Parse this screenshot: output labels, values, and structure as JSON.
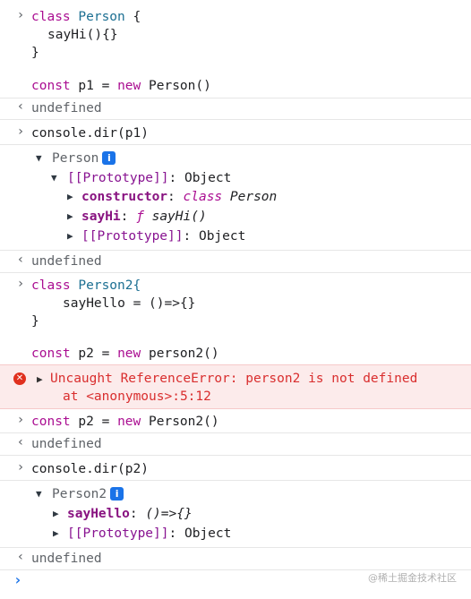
{
  "console": {
    "in1": {
      "line1": [
        "class",
        "Person",
        "{"
      ],
      "line2": "sayHi(){}",
      "line3": "}",
      "line4": [
        "const",
        "p1",
        "=",
        "new",
        "Person()"
      ]
    },
    "out1": "undefined",
    "in2": "console.dir(p1)",
    "dir1": {
      "root": "Person",
      "proto_label": "[[Prototype]]",
      "proto_value": "Object",
      "constructor_key": "constructor",
      "constructor_kw": "class",
      "constructor_val": "Person",
      "sayhi_key": "sayHi",
      "sayhi_f": "ƒ",
      "sayhi_val": "sayHi()",
      "inner_proto_label": "[[Prototype]]",
      "inner_proto_value": "Object"
    },
    "out2": "undefined",
    "in3": {
      "line1": [
        "class",
        "Person2{"
      ],
      "line2": "sayHello = ()=>{}",
      "line3": "}",
      "line4": [
        "const",
        "p2",
        "=",
        "new",
        "person2()"
      ]
    },
    "error": {
      "line1": "Uncaught ReferenceError: person2 is not defined",
      "line2": "at <anonymous>:5:12"
    },
    "in4": [
      "const",
      "p2",
      "=",
      "new",
      "Person2()"
    ],
    "out3": "undefined",
    "in5": "console.dir(p2)",
    "dir2": {
      "root": "Person2",
      "sayhello_key": "sayHello",
      "sayhello_val": "()=>{}",
      "proto_label": "[[Prototype]]",
      "proto_value": "Object"
    },
    "out4": "undefined"
  },
  "watermark": "@稀土掘金技术社区",
  "icons": {
    "input_prompt": "chevron-right-icon",
    "output_prompt": "chevron-left-icon",
    "info": "info-icon",
    "error": "error-x-icon"
  }
}
